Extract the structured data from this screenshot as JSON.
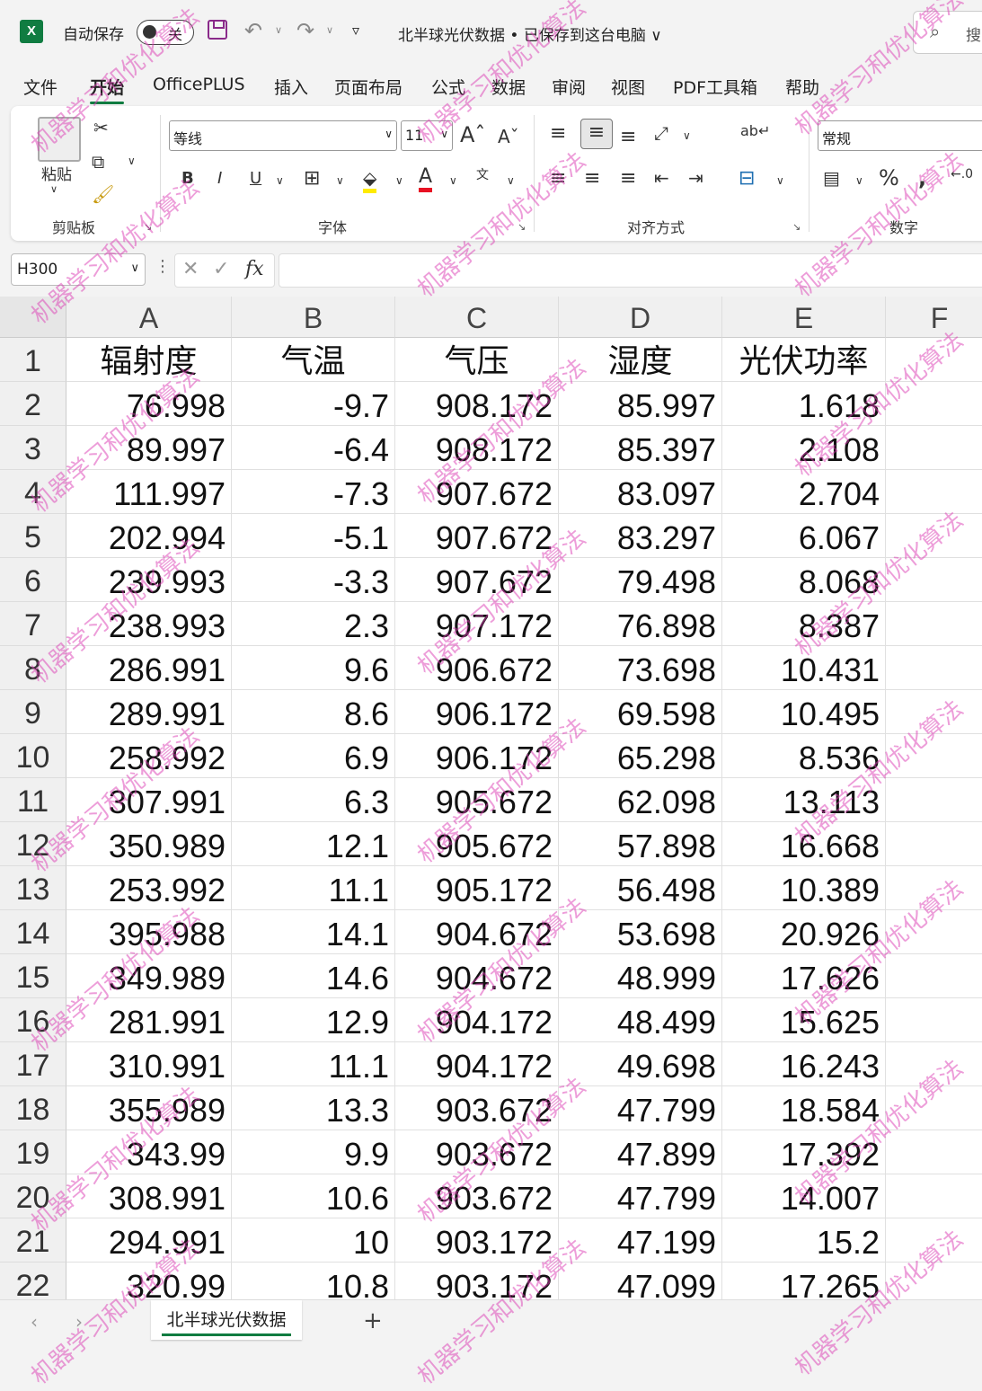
{
  "titlebar": {
    "app_icon": "X",
    "autosave_label": "自动保存",
    "autosave_state": "关",
    "doc_title": "北半球光伏数据 • 已保存到这台电脑 ∨",
    "search_placeholder": "搜"
  },
  "menu": {
    "items": [
      "文件",
      "开始",
      "OfficePLUS",
      "插入",
      "页面布局",
      "公式",
      "数据",
      "审阅",
      "视图",
      "PDF工具箱",
      "帮助"
    ],
    "active": "开始"
  },
  "ribbon": {
    "clipboard": {
      "label": "剪贴板",
      "paste": "粘贴"
    },
    "font": {
      "label": "字体",
      "name": "等线",
      "size": "11"
    },
    "align": {
      "label": "对齐方式"
    },
    "number": {
      "label": "数字",
      "format": "常规",
      "percent": "%"
    }
  },
  "formula_bar": {
    "name_box": "H300",
    "formula": ""
  },
  "columns": [
    "A",
    "B",
    "C",
    "D",
    "E",
    "F"
  ],
  "headers": [
    "辐射度",
    "气温",
    "气压",
    "湿度",
    "光伏功率"
  ],
  "rows": [
    [
      "76.998",
      "-9.7",
      "908.172",
      "85.997",
      "1.618"
    ],
    [
      "89.997",
      "-6.4",
      "908.172",
      "85.397",
      "2.108"
    ],
    [
      "111.997",
      "-7.3",
      "907.672",
      "83.097",
      "2.704"
    ],
    [
      "202.994",
      "-5.1",
      "907.672",
      "83.297",
      "6.067"
    ],
    [
      "239.993",
      "-3.3",
      "907.672",
      "79.498",
      "8.068"
    ],
    [
      "238.993",
      "2.3",
      "907.172",
      "76.898",
      "8.387"
    ],
    [
      "286.991",
      "9.6",
      "906.672",
      "73.698",
      "10.431"
    ],
    [
      "289.991",
      "8.6",
      "906.172",
      "69.598",
      "10.495"
    ],
    [
      "258.992",
      "6.9",
      "906.172",
      "65.298",
      "8.536"
    ],
    [
      "307.991",
      "6.3",
      "905.672",
      "62.098",
      "13.113"
    ],
    [
      "350.989",
      "12.1",
      "905.672",
      "57.898",
      "16.668"
    ],
    [
      "253.992",
      "11.1",
      "905.172",
      "56.498",
      "10.389"
    ],
    [
      "395.988",
      "14.1",
      "904.672",
      "53.698",
      "20.926"
    ],
    [
      "349.989",
      "14.6",
      "904.672",
      "48.999",
      "17.626"
    ],
    [
      "281.991",
      "12.9",
      "904.172",
      "48.499",
      "15.625"
    ],
    [
      "310.991",
      "11.1",
      "904.172",
      "49.698",
      "16.243"
    ],
    [
      "355.989",
      "13.3",
      "903.672",
      "47.799",
      "18.584"
    ],
    [
      "343.99",
      "9.9",
      "903.672",
      "47.899",
      "17.392"
    ],
    [
      "308.991",
      "10.6",
      "903.672",
      "47.799",
      "14.007"
    ],
    [
      "294.991",
      "10",
      "903.172",
      "47.199",
      "15.2"
    ],
    [
      "320.99",
      "10.8",
      "903.172",
      "47.099",
      "17.265"
    ]
  ],
  "sheet": {
    "tab": "北半球光伏数据",
    "add": "+"
  },
  "watermark_text": "机器学习和优化算法"
}
